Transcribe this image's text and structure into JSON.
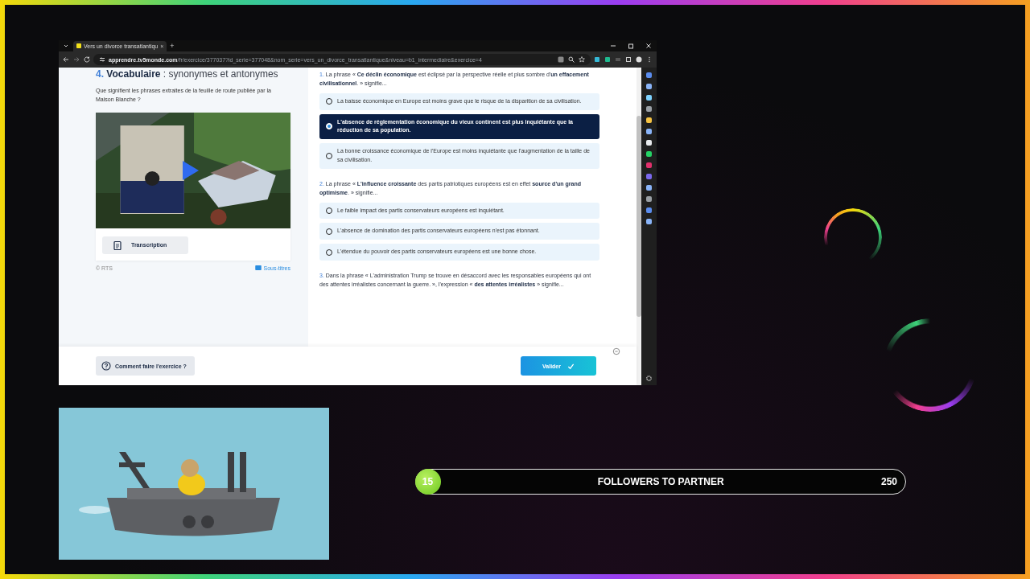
{
  "browser": {
    "tab_title": "Vers un divorce transatlantiqu",
    "tab_close": "×",
    "new_tab": "+",
    "url_host": "apprendre.tv5monde.com",
    "url_path": "/fr/exercice/377037?id_serie=377048&nom_serie=vers_un_divorce_transatlantique&niveau=b1_intermediaire&exercice=4"
  },
  "lesson": {
    "heading_number": "4.",
    "heading": "**Vocabulaire** : synonymes et antonymes",
    "intro": "Que signifient les phrases extraites de la feuille de route publiée par la Maison Blanche ?",
    "transcription_button": "Transcription",
    "credit": "© RTS",
    "subtitles_link": "Sous-titres"
  },
  "questions": [
    {
      "number": "1.",
      "prompt": "La phrase « **Ce déclin économique** est éclipsé par la perspective réelle et plus sombre d'**un effacement civilisationnel**. » signifie...",
      "options": [
        {
          "text": "La baisse économique en Europe est moins grave que le risque de la disparition de sa civilisation.",
          "selected": false
        },
        {
          "text": "L'absence de réglementation économique du vieux continent est plus inquiétante que la réduction de sa population.",
          "selected": true
        },
        {
          "text": "La bonne croissance économique de l'Europe est moins inquiétante que l'augmentation de la taille de sa civilisation.",
          "selected": false
        }
      ]
    },
    {
      "number": "2.",
      "prompt": "La phrase « **L'influence croissante** des partis patriotiques européens est en effet **source d'un grand optimisme**. » signifie...",
      "options": [
        {
          "text": "Le faible impact des partis conservateurs européens est inquiétant.",
          "selected": false
        },
        {
          "text": "L'absence de domination des partis conservateurs européens n'est pas étonnant.",
          "selected": false
        },
        {
          "text": "L'étendue du pouvoir des partis conservateurs européens est une bonne chose.",
          "selected": false
        }
      ]
    },
    {
      "number": "3.",
      "prompt": "Dans la phrase « L'administration Trump se trouve en désaccord avec les responsables européens qui ont des attentes irréalistes concernant la guerre. », l'expression « **des attentes irréalistes** » signifie..."
    }
  ],
  "footer": {
    "help_button": "Comment faire l'exercice ?",
    "submit_button": "Valider"
  },
  "followers": {
    "count": "15",
    "label": "FOLLOWERS TO PARTNER",
    "goal": "250"
  }
}
